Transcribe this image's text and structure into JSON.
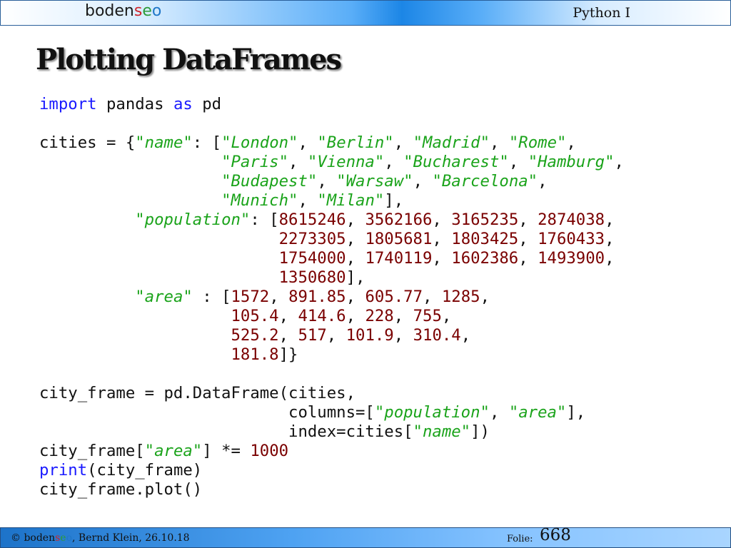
{
  "header": {
    "logo_parts": [
      "boden",
      "s",
      "e",
      "o"
    ],
    "course": "Python I"
  },
  "slide": {
    "title": "Plotting DataFrames"
  },
  "code": {
    "l1_import": "import",
    "l1_pandas": " pandas ",
    "l1_as": "as",
    "l1_pd": " pd",
    "l3_a": "cities = {",
    "l3_name": "\"name\"",
    "l3_b": ": [",
    "l3_london": "\"London\"",
    "l3_berlin": "\"Berlin\"",
    "l3_madrid": "\"Madrid\"",
    "l3_rome": "\"Rome\"",
    "l4_paris": "\"Paris\"",
    "l4_vienna": "\"Vienna\"",
    "l4_bucharest": "\"Bucharest\"",
    "l4_hamburg": "\"Hamburg\"",
    "l5_budapest": "\"Budapest\"",
    "l5_warsaw": "\"Warsaw\"",
    "l5_barcelona": "\"Barcelona\"",
    "l6_munich": "\"Munich\"",
    "l6_milan": "\"Milan\"",
    "l7_population": "\"population\"",
    "pop": [
      "8615246",
      "3562166",
      "3165235",
      "2874038",
      "2273305",
      "1805681",
      "1803425",
      "1760433",
      "1754000",
      "1740119",
      "1602386",
      "1493900",
      "1350680"
    ],
    "l11_area": "\"area\"",
    "area": [
      "1572",
      "891.85",
      "605.77",
      "1285",
      "105.4",
      "414.6",
      "228",
      "755",
      "525.2",
      "517",
      "101.9",
      "310.4",
      "181.8"
    ],
    "l16": "city_frame = pd.DataFrame(cities,",
    "l17_a": "columns=[",
    "l17_pop": "\"population\"",
    "l17_area": "\"area\"",
    "l17_b": "],",
    "l18_a": "index=cities[",
    "l18_name": "\"name\"",
    "l18_b": "])",
    "l19_a": "city_frame[",
    "l19_area": "\"area\"",
    "l19_b": "] *= ",
    "l19_num": "1000",
    "l20_print": "print",
    "l20_rest": "(city_frame)",
    "l21": "city_frame.plot()"
  },
  "footer": {
    "copyright": "© ",
    "logo_parts": [
      "boden",
      "s",
      "e",
      "o"
    ],
    "author_date": ", Bernd Klein, 26.10.18",
    "folie_label": "Folie:",
    "folie_number": "668"
  }
}
